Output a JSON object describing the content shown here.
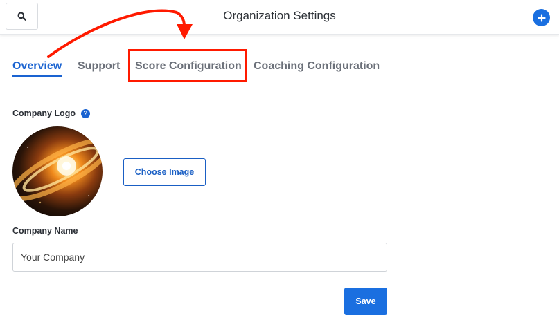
{
  "header": {
    "title": "Organization Settings",
    "search_icon": "search-icon",
    "add_icon": "plus-circle-icon"
  },
  "tabs": [
    {
      "label": "Overview",
      "active": true
    },
    {
      "label": "Support",
      "active": false
    },
    {
      "label": "Score Configuration",
      "active": false
    },
    {
      "label": "Coaching Configuration",
      "active": false
    }
  ],
  "annotation": {
    "highlight_color": "#ff1a00",
    "highlighted_tab": "Score Configuration"
  },
  "form": {
    "company_logo_label": "Company Logo",
    "help_icon": "?",
    "choose_image_label": "Choose Image",
    "company_name_label": "Company Name",
    "company_name_value": "Your Company",
    "save_label": "Save"
  },
  "colors": {
    "accent": "#1a6fe0",
    "link": "#1a63d1"
  }
}
